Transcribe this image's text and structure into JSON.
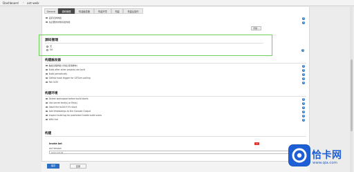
{
  "breadcrumb": {
    "home": "Dashboard",
    "separator": "›",
    "job": "ant-web",
    "separator2": "›"
  },
  "tabs": [
    {
      "label": "General",
      "active": false
    },
    {
      "label": "源码管理",
      "active": true
    },
    {
      "label": "构建触发器",
      "active": false
    },
    {
      "label": "构建环境",
      "active": false
    },
    {
      "label": "构建",
      "active": false
    },
    {
      "label": "构建后操作",
      "active": false
    }
  ],
  "general_options": [
    {
      "label": "丢弃旧的构建"
    },
    {
      "label": "在必要的时候并发构建"
    }
  ],
  "advanced_button": "高级...",
  "scm": {
    "title": "源码管理",
    "options": [
      {
        "label": "无",
        "selected": true
      },
      {
        "label": "Git",
        "selected": false
      }
    ]
  },
  "triggers": {
    "title": "构建触发器",
    "options": [
      {
        "label": "触发远程构建 (例如,使用脚本)"
      },
      {
        "label": "Build after other projects are built"
      },
      {
        "label": "Build periodically"
      },
      {
        "label": "GitHub hook trigger for GITScm polling"
      },
      {
        "label": "Poll SCM"
      }
    ]
  },
  "environment": {
    "title": "构建环境",
    "options": [
      {
        "label": "Delete workspace before build starts"
      },
      {
        "label": "Use secret text(s) or file(s)"
      },
      {
        "label": "Abort the build if it's stuck"
      },
      {
        "label": "Add timestamps to the Console Output"
      },
      {
        "label": "Inspect build log for published Gradle build scans"
      },
      {
        "label": "With Ant"
      }
    ]
  },
  "build": {
    "title": "构建",
    "step_title": "Invoke Ant",
    "ant_version_label": "Ant Version",
    "ant_version_value": "ant-1.10.12",
    "delete_label": "X"
  },
  "footer": {
    "save": "保存",
    "apply": "应用"
  },
  "watermark": {
    "title": "恰卡网",
    "url": "www.qia.com"
  },
  "colors": {
    "accent": "#2b6cc4",
    "highlight_border": "#6fcf5b",
    "help_icon": "#2f74c0",
    "active_tab": "#4a4a4a"
  }
}
